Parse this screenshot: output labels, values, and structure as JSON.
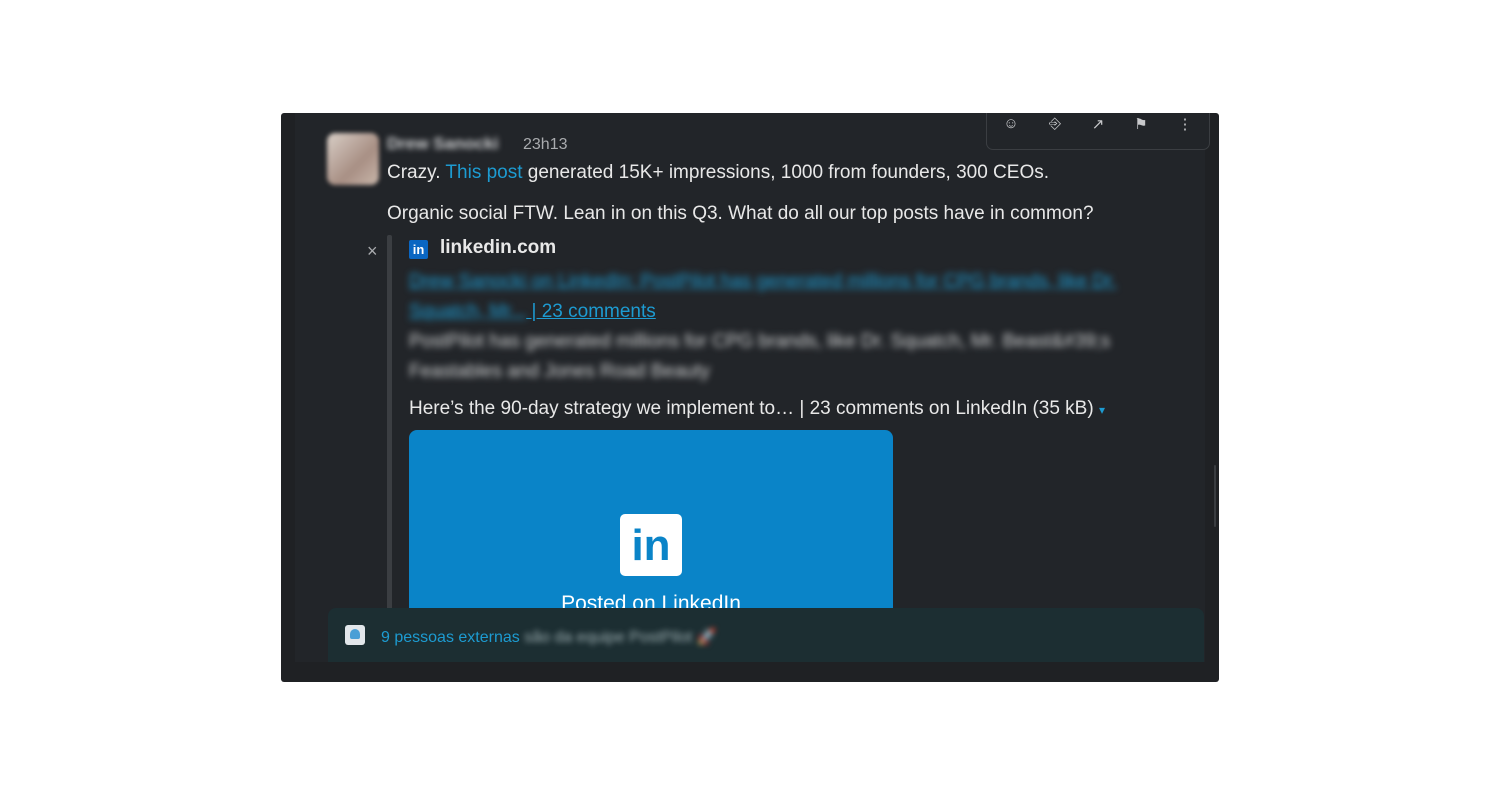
{
  "message": {
    "author": "Drew Sanocki",
    "timestamp": "23h13",
    "line1_pre": "Crazy. ",
    "line1_link": "This post",
    "line1_post": " generated 15K+ impressions, 1000 from founders, 300 CEOs.",
    "line2": "Organic social FTW. Lean in on this Q3. What do all our top posts have in common?"
  },
  "actions": {
    "icons": [
      "emoji-icon",
      "reply-icon",
      "share-icon",
      "bookmark-icon",
      "more-icon"
    ],
    "glyphs": [
      "☺",
      "⎆",
      "↗",
      "⚑",
      "⋮"
    ]
  },
  "attachment": {
    "close_label": "×",
    "site": "linkedin.com",
    "title_blurred": "Drew Sanocki on LinkedIn: PostPilot has generated millions for CPG brands, like Dr. Squatch, Mr...",
    "title_visible": " | 23 comments",
    "desc_blurred": "PostPilot has generated millions for CPG brands, like Dr. Squatch, Mr. Beast&#39;s Feastables and Jones Road Beauty",
    "file_line": "Here’s the 90-day strategy we implement to… | 23 comments on LinkedIn (35 kB)",
    "caret": "▾",
    "preview_logo": "in",
    "preview_caption": "Posted on LinkedIn"
  },
  "footer": {
    "count_text": "9 pessoas externas",
    "rest_text": " são da equipe PostPilot 🚀"
  },
  "colors": {
    "accent": "#1d9bd1",
    "linkedin": "#0a84c8",
    "background": "#222529",
    "footer": "#1c2e32"
  }
}
